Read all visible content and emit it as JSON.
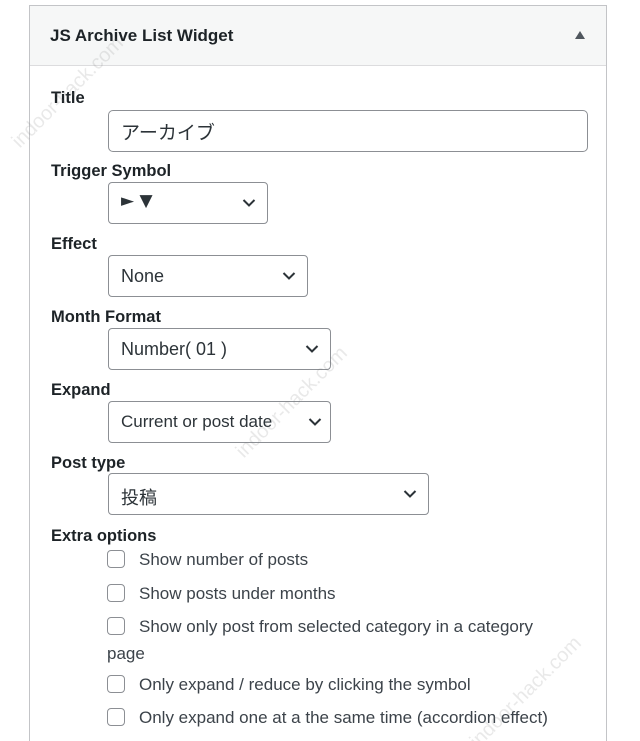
{
  "widget": {
    "title": "JS Archive List Widget"
  },
  "fields": {
    "title": {
      "label": "Title",
      "value": "アーカイブ"
    },
    "trigger_symbol": {
      "label": "Trigger Symbol",
      "selected": "► ▼"
    },
    "effect": {
      "label": "Effect",
      "selected": "None"
    },
    "month_format": {
      "label": "Month Format",
      "selected": "Number( 01 )"
    },
    "expand": {
      "label": "Expand",
      "selected": "Current or post date"
    },
    "post_type": {
      "label": "Post type",
      "selected": "投稿"
    }
  },
  "extra_options": {
    "label": "Extra options",
    "items": [
      {
        "label": "Show number of posts",
        "checked": false
      },
      {
        "label": "Show posts under months",
        "checked": false
      },
      {
        "label": "Show only post from selected category in a category",
        "label_cont": "page",
        "checked": false
      },
      {
        "label": "Only expand / reduce by clicking the symbol",
        "checked": false
      },
      {
        "label": "Only expand one at a the same time (accordion effect)",
        "checked": false
      }
    ]
  },
  "watermark": "indoor-hack.com"
}
